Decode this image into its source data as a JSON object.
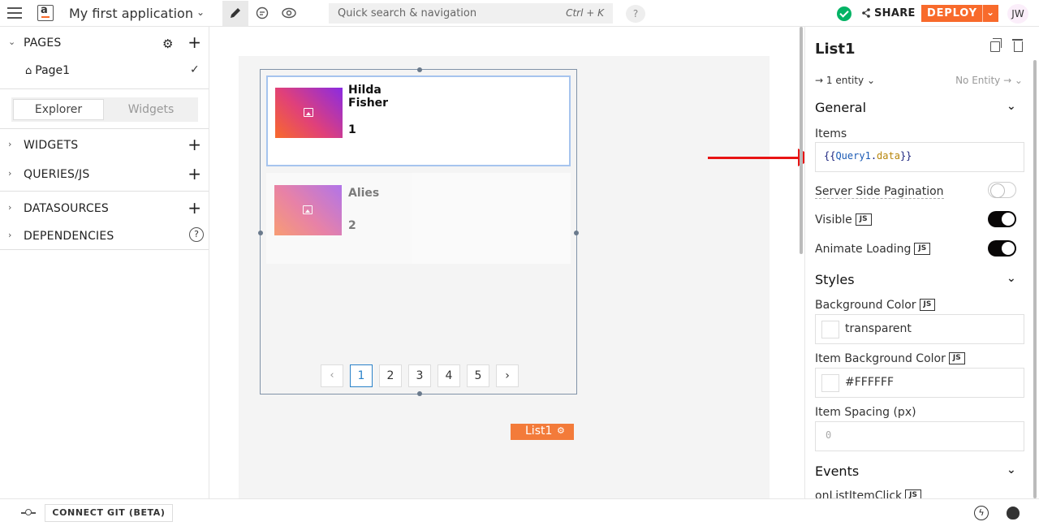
{
  "header": {
    "app_title": "My first application",
    "search_placeholder": "Quick search & navigation",
    "search_shortcut": "Ctrl + K",
    "help": "?",
    "share": "SHARE",
    "deploy": "DEPLOY",
    "avatar_initials": "JW"
  },
  "sidebar": {
    "pages_label": "PAGES",
    "page_name": "Page1",
    "tabs": [
      "Explorer",
      "Widgets"
    ],
    "sections": [
      {
        "label": "WIDGETS"
      },
      {
        "label": "QUERIES/JS"
      },
      {
        "label": "DATASOURCES"
      },
      {
        "label": "DEPENDENCIES"
      }
    ]
  },
  "canvas": {
    "items": [
      {
        "name": "Hilda Fisher",
        "number": "1"
      },
      {
        "name": "Alies",
        "number": "2"
      }
    ],
    "pagination": {
      "pages": [
        "1",
        "2",
        "3",
        "4",
        "5"
      ],
      "active": "1",
      "prev": "‹",
      "next": "›"
    },
    "widget_tag": "List1"
  },
  "properties": {
    "widget_name": "List1",
    "entity": "1 entity",
    "no_entity": "No Entity",
    "general": "General",
    "items_label": "Items",
    "items_code": {
      "open": "{{",
      "query": "Query1",
      "dot": ".",
      "field": "data",
      "close": "}}"
    },
    "server_side_pagination": "Server Side Pagination",
    "visible": "Visible",
    "animate_loading": "Animate Loading",
    "styles": "Styles",
    "bg_color_label": "Background Color",
    "bg_color_value": "transparent",
    "item_bg_color_label": "Item Background Color",
    "item_bg_color_value": "#FFFFFF",
    "item_spacing_label": "Item Spacing (px)",
    "item_spacing_value": "0",
    "events": "Events",
    "on_list_item_click": "onListItemClick",
    "js": "JS",
    "toggles": {
      "server_side_pagination": false,
      "visible": true,
      "animate_loading": true
    }
  },
  "footer": {
    "connect_git": "CONNECT GIT (BETA)"
  },
  "colors": {
    "brand": "#f86a2b",
    "success": "#03b365",
    "annotation_arrow": "#e81414"
  }
}
